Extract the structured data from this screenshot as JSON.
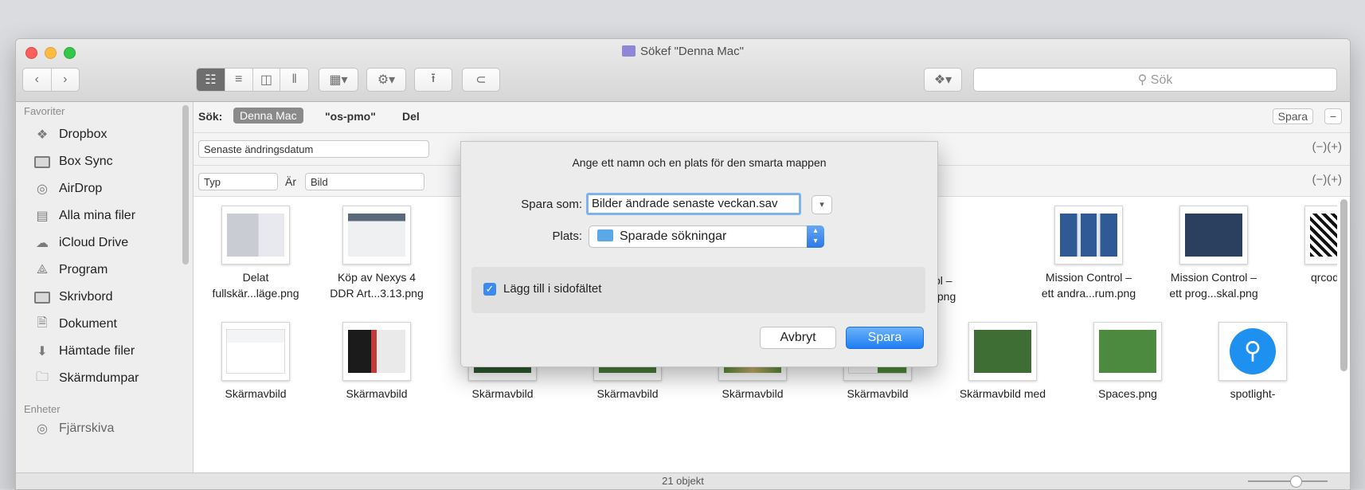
{
  "window": {
    "title": "Sökef \"Denna Mac\""
  },
  "toolbar": {
    "back_icon": "chevron-left-icon",
    "forward_icon": "chevron-right-icon",
    "search_placeholder": "Sök"
  },
  "sidebar": {
    "favorites_header": "Favoriter",
    "items": [
      {
        "label": "Dropbox",
        "icon": "dropbox-icon"
      },
      {
        "label": "Box Sync",
        "icon": "box-sync-icon"
      },
      {
        "label": "AirDrop",
        "icon": "airdrop-icon"
      },
      {
        "label": "Alla mina filer",
        "icon": "all-files-icon"
      },
      {
        "label": "iCloud Drive",
        "icon": "cloud-icon"
      },
      {
        "label": "Program",
        "icon": "applications-icon"
      },
      {
        "label": "Skrivbord",
        "icon": "desktop-icon"
      },
      {
        "label": "Dokument",
        "icon": "document-icon"
      },
      {
        "label": "Hämtade filer",
        "icon": "download-icon"
      },
      {
        "label": "Skärmdumpar",
        "icon": "folder-icon"
      }
    ],
    "devices_header": "Enheter",
    "device_item": "Fjärrskiva"
  },
  "searchbar": {
    "label": "Sök:",
    "scope_active": "Denna Mac",
    "scope_2": "\"os-pmo\"",
    "scope_3": "Del",
    "save": "Spara",
    "minus": "−"
  },
  "rules": {
    "rule1": "Senaste ändringsdatum",
    "rule1_tail": "◊)",
    "rule2_type": "Typ",
    "rule2_op": "Är",
    "rule2_value": "Bild",
    "plusminus": "(−)(+)"
  },
  "files_row1": [
    {
      "name_l1": "Delat",
      "name_l2": "fullskär...läge.png"
    },
    {
      "name_l1": "Köp av Nexys 4",
      "name_l2": "DDR Art...3.13.png"
    },
    {
      "name_l1": "",
      "name_l2": ""
    },
    {
      "name_l1": "",
      "name_l2": ""
    },
    {
      "name_l1": "",
      "name_l2": ""
    },
    {
      "name_l1": "pl –",
      "name_l2": ".png"
    },
    {
      "name_l1": "Mission Control –",
      "name_l2": "ett andra...rum.png"
    },
    {
      "name_l1": "Mission Control –",
      "name_l2": "ett prog...skal.png"
    },
    {
      "name_l1": "qrcode.png",
      "name_l2": ""
    }
  ],
  "files_row2": [
    {
      "name": "Skärmavbild"
    },
    {
      "name": "Skärmavbild"
    },
    {
      "name": "Skärmavbild"
    },
    {
      "name": "Skärmavbild"
    },
    {
      "name": "Skärmavbild"
    },
    {
      "name": "Skärmavbild"
    },
    {
      "name": "Skärmavbild med"
    },
    {
      "name": "Spaces.png"
    },
    {
      "name": "spotlight-"
    }
  ],
  "status": {
    "count": "21 objekt"
  },
  "dialog": {
    "prompt": "Ange ett namn och en plats för den smarta mappen",
    "save_as_label": "Spara som:",
    "save_as_value": "Bilder ändrade senaste veckan.sav",
    "location_label": "Plats:",
    "location_value": "Sparade sökningar",
    "sidebar_checkbox": "Lägg till i sidofältet",
    "cancel": "Avbryt",
    "save": "Spara"
  },
  "colors": {
    "accent": "#3b8af0",
    "sidebar_bg": "#eeeeef"
  }
}
